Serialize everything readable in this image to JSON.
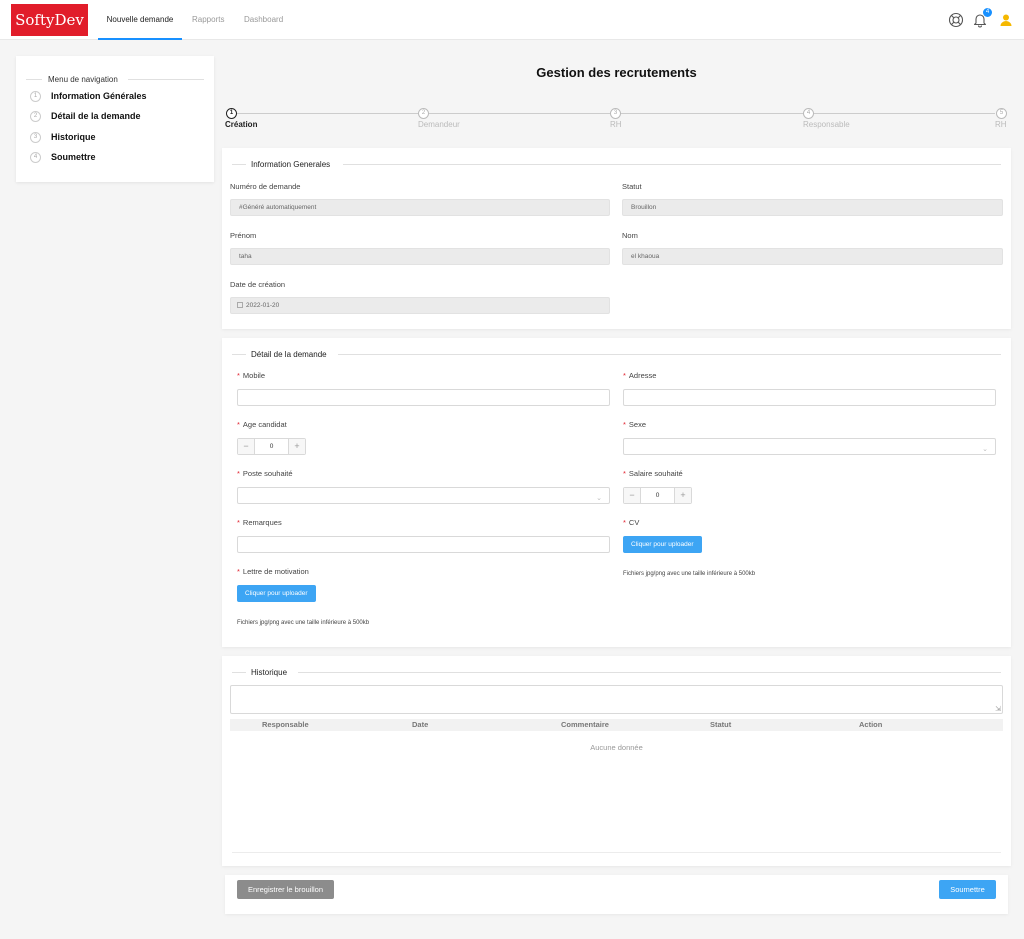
{
  "header": {
    "logo": "SoftyDev",
    "tabs": [
      {
        "label": "Nouvelle demande",
        "active": true
      },
      {
        "label": "Rapports",
        "active": false
      },
      {
        "label": "Dashboard",
        "active": false
      }
    ],
    "notification_count": "4",
    "icons": [
      "lifebuoy-icon",
      "bell-icon",
      "user-icon"
    ],
    "colors": {
      "brand": "#e11d2a",
      "accent": "#1890ff",
      "user": "#f5b800"
    }
  },
  "sidebar": {
    "title": "Menu de navigation",
    "items": [
      {
        "num": "1",
        "label": "Information Générales"
      },
      {
        "num": "2",
        "label": "Détail de la demande"
      },
      {
        "num": "3",
        "label": "Historique"
      },
      {
        "num": "4",
        "label": "Soumettre"
      }
    ]
  },
  "page": {
    "title": "Gestion des recrutements",
    "steps": [
      {
        "num": "1",
        "label": "Création",
        "active": true
      },
      {
        "num": "2",
        "label": "Demandeur",
        "active": false
      },
      {
        "num": "3",
        "label": "RH",
        "active": false
      },
      {
        "num": "4",
        "label": "Responsable",
        "active": false
      },
      {
        "num": "5",
        "label": "RH",
        "active": false
      }
    ]
  },
  "info": {
    "legend": "Information Generales",
    "numero_label": "Numéro de demande",
    "numero_value": "#Généré automatiquement",
    "statut_label": "Statut",
    "statut_value": "Brouillon",
    "prenom_label": "Prénom",
    "prenom_value": "taha",
    "nom_label": "Nom",
    "nom_value": "el khaoua",
    "date_label": "Date de création",
    "date_value": "2022-01-20"
  },
  "detail": {
    "legend": "Détail de la demande",
    "required_mark": "*",
    "mobile_label": "Mobile",
    "adresse_label": "Adresse",
    "age_label": "Age candidat",
    "age_value": "0",
    "sexe_label": "Sexe",
    "poste_label": "Poste souhaité",
    "salaire_label": "Salaire souhaité",
    "salaire_value": "0",
    "remarques_label": "Remarques",
    "cv_label": "CV",
    "upload_label": "Cliquer pour uploader",
    "lettre_label": "Lettre de motivation",
    "hint": "Fichiers jpg/png avec une taille inférieure à 500kb",
    "minus": "−",
    "plus": "+"
  },
  "historique": {
    "legend": "Historique",
    "columns": [
      "Responsable",
      "Date",
      "Commentaire",
      "Statut",
      "Action"
    ],
    "empty": "Aucune donnée"
  },
  "footer": {
    "draft_label": "Enregistrer le brouillon",
    "submit_label": "Soumettre"
  }
}
